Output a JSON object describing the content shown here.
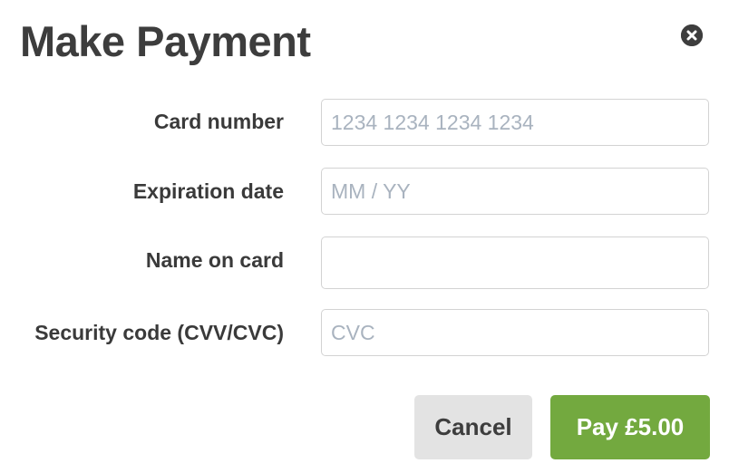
{
  "dialog": {
    "title": "Make Payment",
    "close_icon": "close-circle-icon"
  },
  "form": {
    "card_number": {
      "label": "Card number",
      "value": "",
      "placeholder": "1234 1234 1234 1234"
    },
    "expiration_date": {
      "label": "Expiration date",
      "value": "",
      "placeholder": "MM / YY"
    },
    "name_on_card": {
      "label": "Name on card",
      "value": "",
      "placeholder": ""
    },
    "security_code": {
      "label": "Security code (CVV/CVC)",
      "value": "",
      "placeholder": "CVC"
    }
  },
  "actions": {
    "cancel_label": "Cancel",
    "pay_label": "Pay £5.00"
  },
  "colors": {
    "pay_button": "#73a93f",
    "cancel_button": "#e3e3e3",
    "placeholder_text": "#a9b3bf",
    "field_border": "#d3d3d3",
    "title_text": "#3d3d3d"
  }
}
